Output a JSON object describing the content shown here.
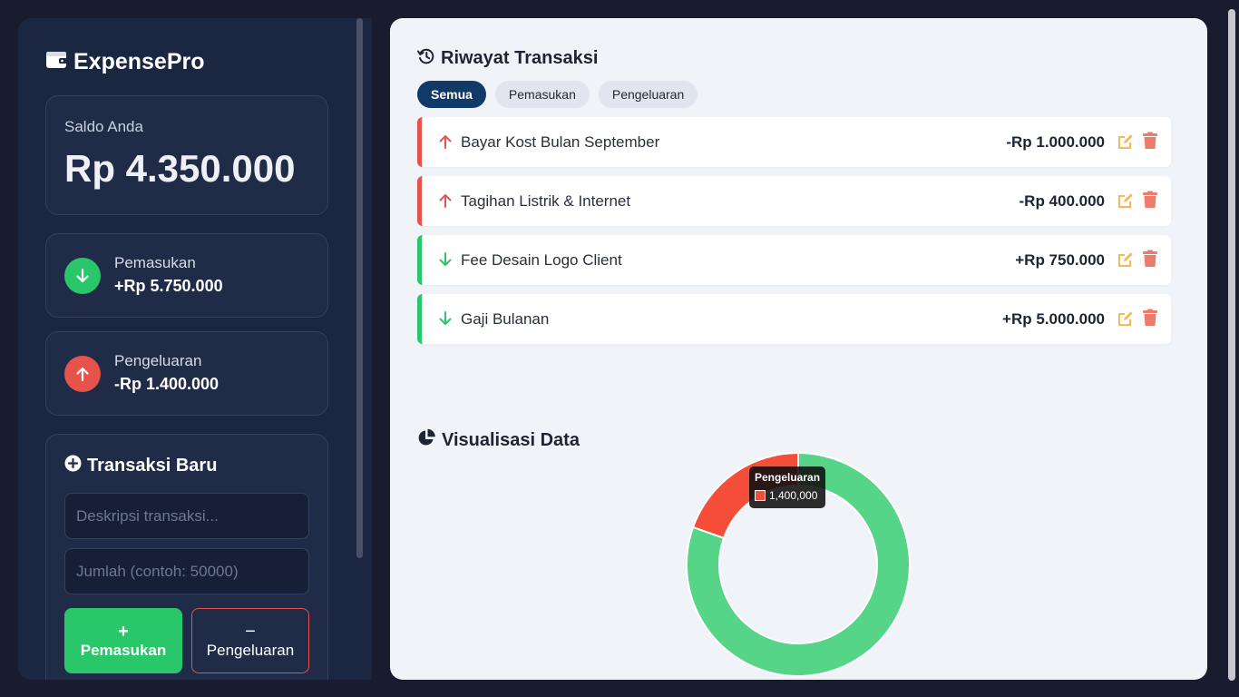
{
  "app": {
    "name": "ExpensePro"
  },
  "balance": {
    "label": "Saldo Anda",
    "value": "Rp 4.350.000"
  },
  "income": {
    "label": "Pemasukan",
    "value": "+Rp 5.750.000"
  },
  "expense": {
    "label": "Pengeluaran",
    "value": "-Rp 1.400.000"
  },
  "form": {
    "title": "Transaksi Baru",
    "desc_placeholder": "Deskripsi transaksi...",
    "amount_placeholder": "Jumlah (contoh: 50000)",
    "income_button": {
      "symbol": "+",
      "label": "Pemasukan"
    },
    "expense_button": {
      "symbol": "−",
      "label": "Pengeluaran"
    }
  },
  "history": {
    "title": "Riwayat Transaksi",
    "filters": [
      "Semua",
      "Pemasukan",
      "Pengeluaran"
    ],
    "active_filter": "Semua",
    "transactions": [
      {
        "type": "expense",
        "description": "Bayar Kost Bulan September",
        "amount": "-Rp 1.000.000"
      },
      {
        "type": "expense",
        "description": "Tagihan Listrik & Internet",
        "amount": "-Rp 400.000"
      },
      {
        "type": "income",
        "description": "Fee Desain Logo Client",
        "amount": "+Rp 750.000"
      },
      {
        "type": "income",
        "description": "Gaji Bulanan",
        "amount": "+Rp 5.000.000"
      }
    ]
  },
  "visualization": {
    "title": "Visualisasi Data"
  },
  "colors": {
    "income": "#2ac66a",
    "expense": "#e5534b",
    "chart_income": "#56d488",
    "chart_expense": "#f44e3b",
    "edit_icon": "#f5b95a",
    "delete_icon": "#ee7a6c"
  },
  "chart_data": {
    "type": "pie",
    "variant": "doughnut",
    "categories": [
      "Pemasukan",
      "Pengeluaran"
    ],
    "values": [
      5750000,
      1400000
    ],
    "tooltip": {
      "label": "Pengeluaran",
      "value": "1,400,000"
    }
  }
}
